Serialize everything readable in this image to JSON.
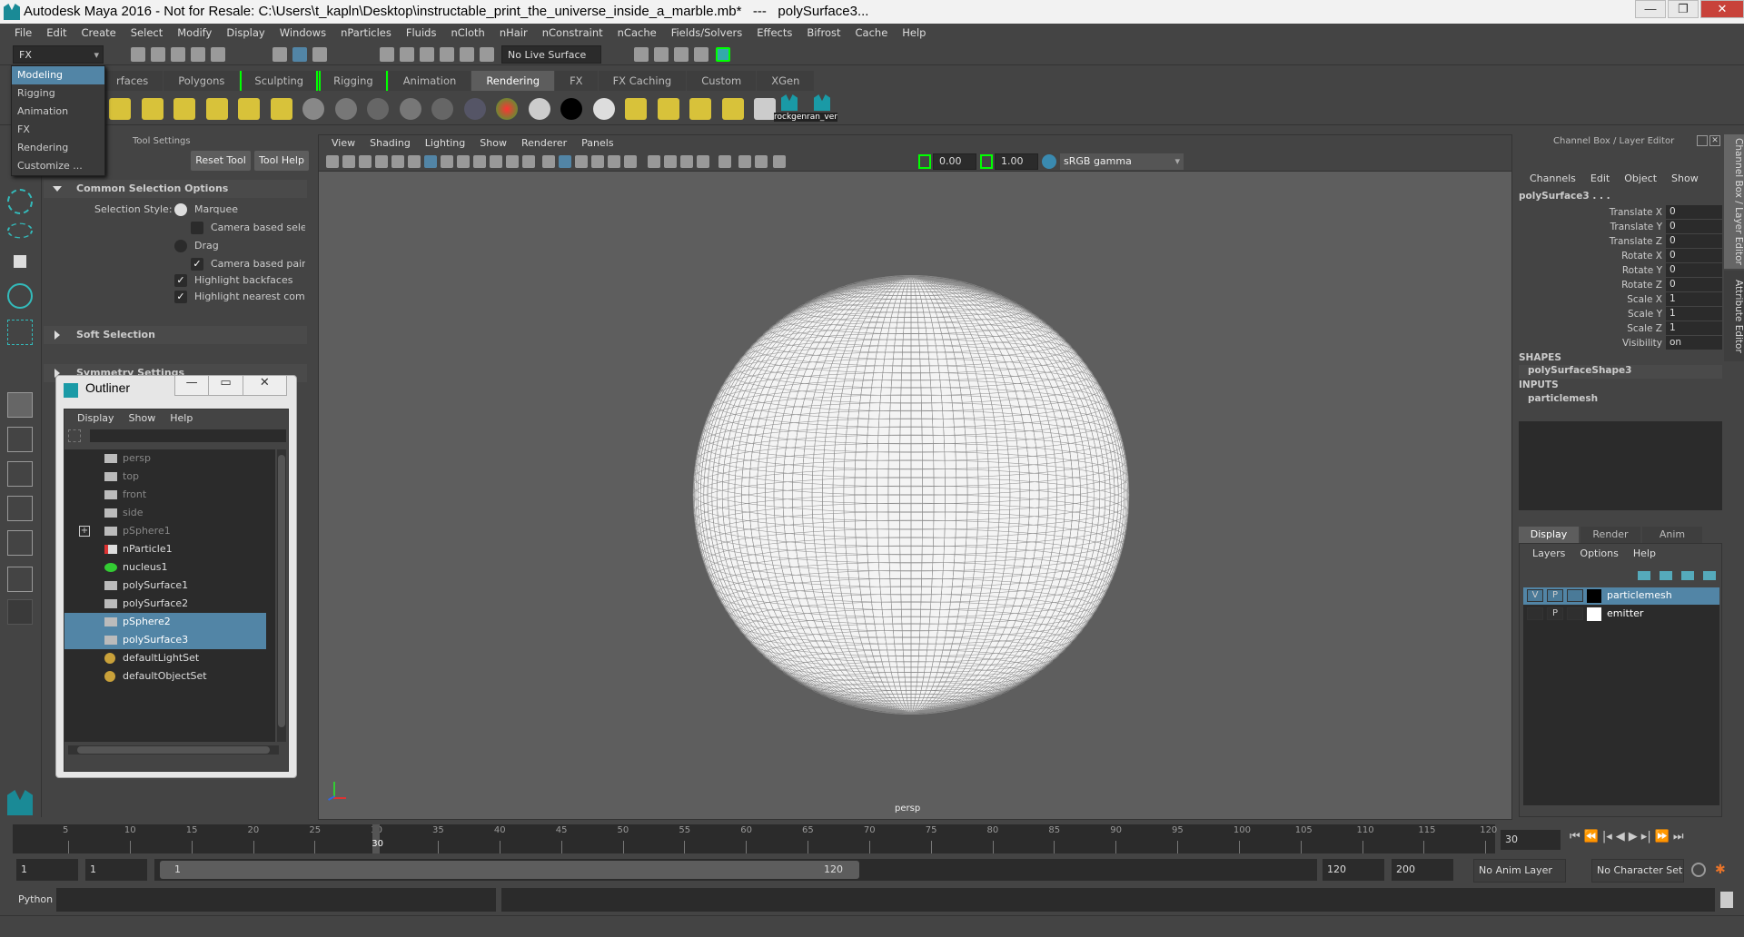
{
  "window": {
    "title": "Autodesk Maya 2016 - Not for Resale: C:\\Users\\t_kapln\\Desktop\\instructable_print_the_universe_inside_a_marble.mb*   ---   polySurface3...",
    "min": "—",
    "max": "❐",
    "close": "✕"
  },
  "menubar": [
    "File",
    "Edit",
    "Create",
    "Select",
    "Modify",
    "Display",
    "Windows",
    "nParticles",
    "Fluids",
    "nCloth",
    "nHair",
    "nConstraint",
    "nCache",
    "Fields/Solvers",
    "Effects",
    "Bifrost",
    "Cache",
    "Help"
  ],
  "status": {
    "mode": "FX",
    "live_surface": "No Live Surface"
  },
  "mode_menu": [
    "Modeling",
    "Rigging",
    "Animation",
    "FX",
    "Rendering",
    "Customize ..."
  ],
  "mode_menu_selected": "Modeling",
  "shelf": {
    "tabs": [
      "rfaces",
      "Polygons",
      "Sculpting",
      "Rigging",
      "Animation",
      "Rendering",
      "FX",
      "FX Caching",
      "Custom",
      "XGen"
    ],
    "active": "Rendering",
    "custom_buttons": [
      "rockgen",
      "ran_ver"
    ]
  },
  "tool_settings": {
    "title": "Tool Settings",
    "reset": "Reset Tool",
    "help": "Tool Help",
    "sections": [
      "Common Selection Options",
      "Soft Selection",
      "Symmetry Settings"
    ],
    "selection_style_label": "Selection Style:",
    "options": [
      {
        "label": "Marquee",
        "type": "radio",
        "checked": true
      },
      {
        "label": "Camera based selection",
        "type": "check",
        "checked": false
      },
      {
        "label": "Drag",
        "type": "radio",
        "checked": false
      },
      {
        "label": "Camera based paint selection",
        "type": "check",
        "checked": true
      },
      {
        "label": "Highlight backfaces",
        "type": "check",
        "checked": true
      },
      {
        "label": "Highlight nearest component",
        "type": "check",
        "checked": true
      }
    ]
  },
  "outliner": {
    "title": "Outliner",
    "menu": [
      "Display",
      "Show",
      "Help"
    ],
    "items": [
      {
        "name": "persp",
        "icon": "camera-icon",
        "dim": true
      },
      {
        "name": "top",
        "icon": "camera-icon",
        "dim": true
      },
      {
        "name": "front",
        "icon": "camera-icon",
        "dim": true
      },
      {
        "name": "side",
        "icon": "camera-icon",
        "dim": true
      },
      {
        "name": "pSphere1",
        "icon": "mesh-icon",
        "dim": true,
        "expand": true
      },
      {
        "name": "nParticle1",
        "icon": "particle-icon"
      },
      {
        "name": "nucleus1",
        "icon": "nucleus-icon"
      },
      {
        "name": "polySurface1",
        "icon": "mesh-icon"
      },
      {
        "name": "polySurface2",
        "icon": "mesh-icon"
      },
      {
        "name": "pSphere2",
        "icon": "mesh-icon",
        "selected": true
      },
      {
        "name": "polySurface3",
        "icon": "mesh-icon",
        "selected": true
      },
      {
        "name": "defaultLightSet",
        "icon": "set-icon"
      },
      {
        "name": "defaultObjectSet",
        "icon": "set-icon"
      }
    ]
  },
  "viewport": {
    "menu": [
      "View",
      "Shading",
      "Lighting",
      "Show",
      "Renderer",
      "Panels"
    ],
    "exposure": "0.00",
    "gamma": "1.00",
    "color_space": "sRGB gamma",
    "camera": "persp"
  },
  "channel_box": {
    "title": "Channel Box / Layer Editor",
    "menu": [
      "Channels",
      "Edit",
      "Object",
      "Show"
    ],
    "object": "polySurface3 . . .",
    "attrs": [
      [
        "Translate X",
        "0"
      ],
      [
        "Translate Y",
        "0"
      ],
      [
        "Translate Z",
        "0"
      ],
      [
        "Rotate X",
        "0"
      ],
      [
        "Rotate Y",
        "0"
      ],
      [
        "Rotate Z",
        "0"
      ],
      [
        "Scale X",
        "1"
      ],
      [
        "Scale Y",
        "1"
      ],
      [
        "Scale Z",
        "1"
      ],
      [
        "Visibility",
        "on"
      ]
    ],
    "shapes_label": "SHAPES",
    "shape": "polySurfaceShape3",
    "inputs_label": "INPUTS",
    "input": "particlemesh"
  },
  "layer_editor": {
    "tabs": [
      "Display",
      "Render",
      "Anim"
    ],
    "active": "Display",
    "menu": [
      "Layers",
      "Options",
      "Help"
    ],
    "layers": [
      {
        "name": "particlemesh",
        "v": "V",
        "p": "P",
        "color": "#000000",
        "selected": true
      },
      {
        "name": "emitter",
        "v": "",
        "p": "P",
        "color": "#ffffff",
        "selected": false
      }
    ]
  },
  "side_tabs": [
    "Channel Box / Layer Editor",
    "Attribute Editor"
  ],
  "timeline": {
    "ticks": [
      5,
      10,
      15,
      20,
      25,
      30,
      35,
      40,
      45,
      50,
      55,
      60,
      65,
      70,
      75,
      80,
      85,
      90,
      95,
      100,
      105,
      110,
      115,
      120
    ],
    "current": "30",
    "current_field": "30"
  },
  "range": {
    "start": "1",
    "playback_start": "1",
    "slider_start": "1",
    "slider_end": "120",
    "playback_end": "120",
    "end": "200",
    "anim_layer": "No Anim Layer",
    "character_set": "No Character Set"
  },
  "command_line": {
    "language": "Python",
    "input": ""
  },
  "colors": {
    "accent": "#5285a6",
    "highlight_green": "#00ff00",
    "viewport": "#5e5e5e"
  }
}
